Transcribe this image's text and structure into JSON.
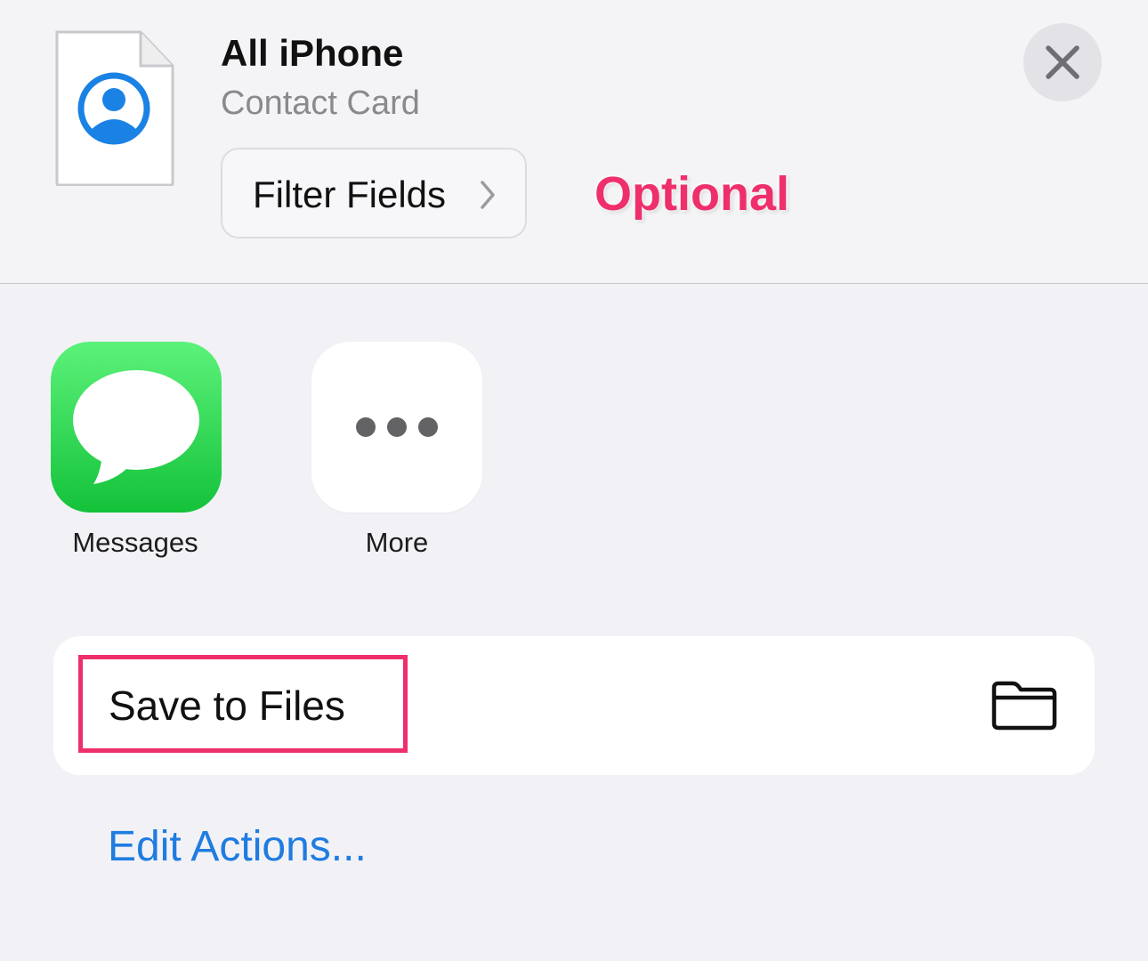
{
  "header": {
    "title": "All iPhone",
    "subtitle": "Contact Card",
    "filter_label": "Filter Fields",
    "annotation": "Optional",
    "document_icon": "contact-document-icon",
    "close_icon": "close-icon"
  },
  "apps": [
    {
      "label": "Messages",
      "icon": "messages-icon"
    },
    {
      "label": "More",
      "icon": "more-ellipsis-icon"
    }
  ],
  "actions": [
    {
      "label": "Save to Files",
      "icon": "folder-icon"
    }
  ],
  "footer": {
    "edit_actions": "Edit Actions..."
  },
  "colors": {
    "background": "#f2f2f6",
    "accent_link": "#1f7ce0",
    "annotation": "#ee2f6b",
    "messages_green": "#14c23a",
    "contact_blue": "#1a82e4"
  }
}
